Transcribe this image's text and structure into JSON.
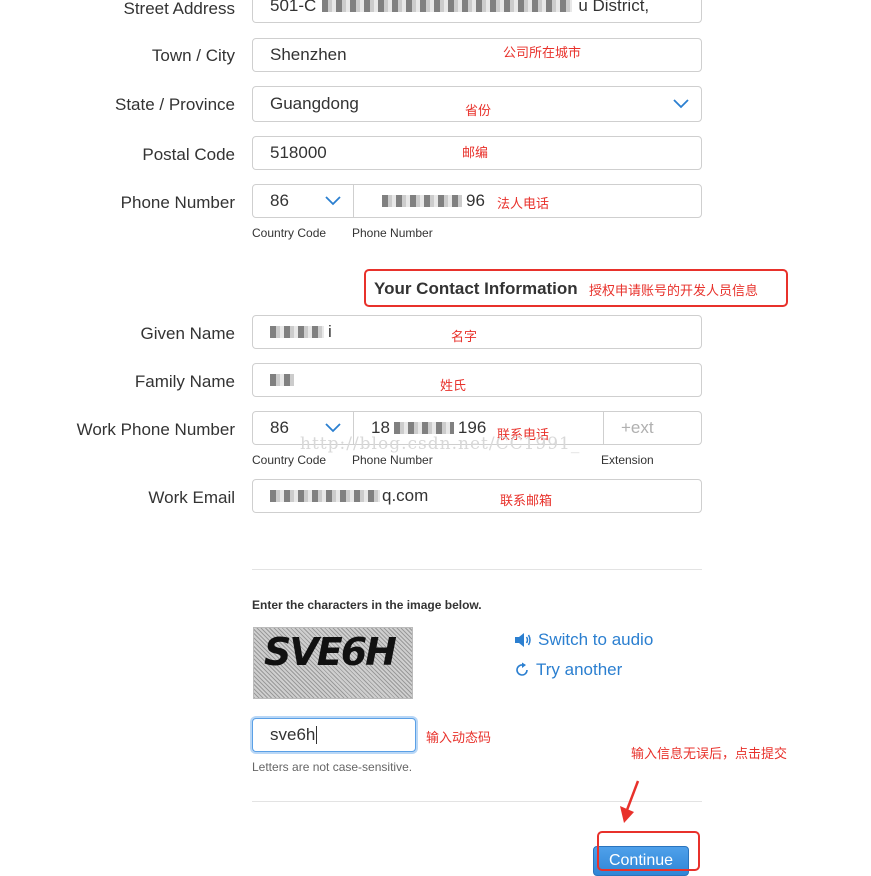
{
  "form": {
    "street_label": "Street Address",
    "street_value": "501-C",
    "street_value_tail": "u District,",
    "city_label": "Town / City",
    "city_value": "Shenzhen",
    "state_label": "State / Province",
    "state_value": "Guangdong",
    "postal_label": "Postal Code",
    "postal_value": "518000",
    "phone_label": "Phone Number",
    "phone_country_code": "86",
    "phone_number_tail": "96",
    "sub_country_code": "Country Code",
    "sub_phone_number": "Phone Number",
    "contact_heading": "Your Contact Information",
    "given_label": "Given Name",
    "given_value_tail": "i",
    "family_label": "Family Name",
    "work_phone_label": "Work Phone Number",
    "work_phone_country_code": "86",
    "work_phone_head": "18",
    "work_phone_tail": "196",
    "ext_placeholder": "+ext",
    "sub_extension": "Extension",
    "email_label": "Work Email",
    "email_value_tail": "q.com"
  },
  "captcha": {
    "instruction": "Enter the characters in the image below.",
    "image_text": "SVE6H",
    "switch_audio": "Switch to audio",
    "try_another": "Try another",
    "input_value": "sve6h",
    "hint": "Letters are not case-sensitive."
  },
  "actions": {
    "continue_label": "Continue"
  },
  "annotations": {
    "city_note": "公司所在城市",
    "state_note": "省份",
    "postal_note": "邮编",
    "phone_note": "法人电话",
    "contact_note": "授权申请账号的开发人员信息",
    "given_note": "名字",
    "family_note": "姓氏",
    "work_phone_note": "联系电话",
    "email_note": "联系邮箱",
    "captcha_note": "输入动态码",
    "submit_note": "输入信息无误后，点击提交"
  },
  "watermark": "http://blog.csdn.net/CC1991_",
  "colors": {
    "accent": "#2b7fd0",
    "annotation_red": "#e8312b",
    "button_blue": "#2f86d6"
  }
}
